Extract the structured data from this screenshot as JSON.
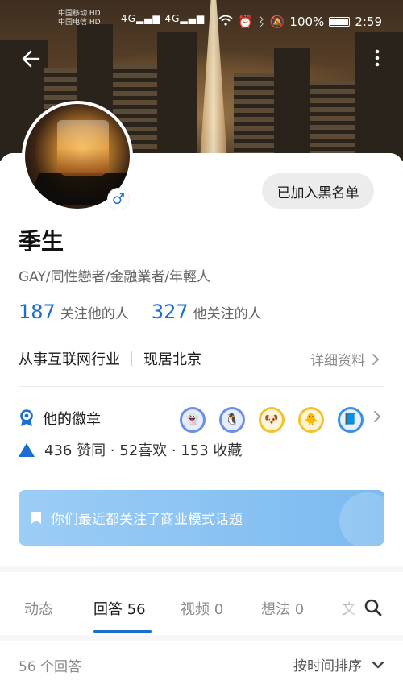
{
  "status_bar": {
    "carrier_1": "中国移动",
    "carrier_2": "中国电信",
    "hd_badge": "HD",
    "network": "4G",
    "battery": "100%",
    "time": "2:59"
  },
  "header": {
    "back_icon": "arrow-left-icon",
    "more_icon": "more-vertical-icon"
  },
  "profile": {
    "name": "季生",
    "bio": "GAY/同性戀者/金融業者/年輕人",
    "gender_icon": "male-icon",
    "blacklist_label": "已加入黑名单",
    "followers_count": "187",
    "followers_label": "关注他的人",
    "following_count": "327",
    "following_label": "他关注的人",
    "industry": "从事互联网行业",
    "location": "现居北京",
    "detail_label": "详细资料"
  },
  "badges": {
    "label": "他的徽章",
    "items": [
      {
        "icon": "badge-creator-icon",
        "color": "#6b8fe8"
      },
      {
        "icon": "badge-answerer-icon",
        "color": "#6b8fe8"
      },
      {
        "icon": "badge-star-icon",
        "color": "#f2c230"
      },
      {
        "icon": "badge-hexagon-icon",
        "color": "#f2c230"
      },
      {
        "icon": "badge-newcomer-icon",
        "color": "#3d8fe0"
      }
    ]
  },
  "stats": {
    "text": "436 赞同 · 52喜欢 · 153 收藏"
  },
  "topic_banner": {
    "text": "你们最近都关注了商业模式话题"
  },
  "tabs": [
    {
      "label": "动态",
      "active": false
    },
    {
      "label": "回答 56",
      "active": true
    },
    {
      "label": "视频 0",
      "active": false
    },
    {
      "label": "想法 0",
      "active": false
    },
    {
      "label": "文",
      "active": false
    }
  ],
  "answers": {
    "count_label": "56 个回答",
    "sort_label": "按时间排序"
  }
}
